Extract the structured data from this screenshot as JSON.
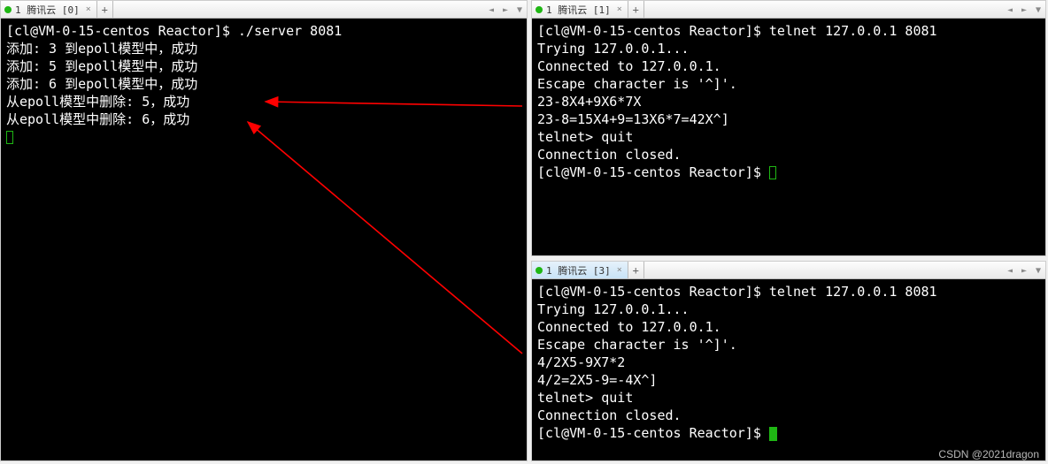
{
  "panes": {
    "left": {
      "tab": {
        "label": "1 腾讯云 [0]"
      },
      "lines": [
        "[cl@VM-0-15-centos Reactor]$ ./server 8081",
        "添加: 3 到epoll模型中，成功",
        "添加: 5 到epoll模型中，成功",
        "添加: 6 到epoll模型中，成功",
        "从epoll模型中删除: 5，成功",
        "从epoll模型中删除: 6，成功"
      ]
    },
    "topRight": {
      "tab": {
        "label": "1 腾讯云 [1]"
      },
      "lines": [
        "[cl@VM-0-15-centos Reactor]$ telnet 127.0.0.1 8081",
        "Trying 127.0.0.1...",
        "Connected to 127.0.0.1.",
        "Escape character is '^]'.",
        "23-8X4+9X6*7X",
        "23-8=15X4+9=13X6*7=42X^]",
        "telnet> quit",
        "Connection closed.",
        "[cl@VM-0-15-centos Reactor]$ "
      ]
    },
    "bottomRight": {
      "tab": {
        "label": "1 腾讯云 [3]"
      },
      "lines": [
        "[cl@VM-0-15-centos Reactor]$ telnet 127.0.0.1 8081",
        "Trying 127.0.0.1...",
        "Connected to 127.0.0.1.",
        "Escape character is '^]'.",
        "4/2X5-9X7*2",
        "4/2=2X5-9=-4X^]",
        "telnet> quit",
        "Connection closed.",
        "[cl@VM-0-15-centos Reactor]$ "
      ]
    }
  },
  "watermark": "CSDN @2021dragon"
}
